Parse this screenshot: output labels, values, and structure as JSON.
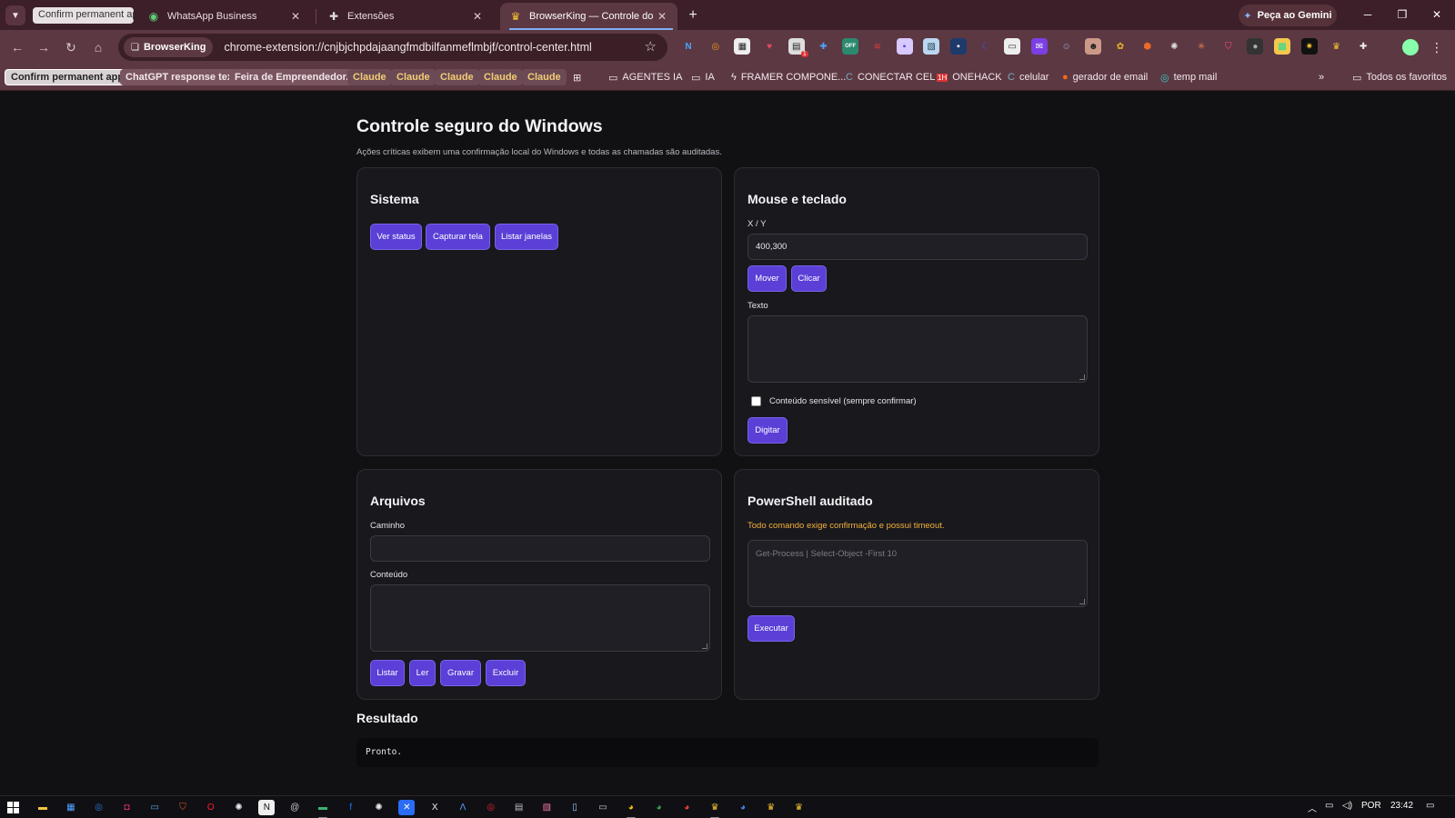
{
  "browser": {
    "tab_group_chip": "Confirm permanent ap",
    "tabs": [
      {
        "title": "WhatsApp Business",
        "icon": "whatsapp-icon"
      },
      {
        "title": "Extensões",
        "icon": "puzzle-icon"
      },
      {
        "title": "BrowserKing — Controle do W",
        "icon": "crown-icon"
      }
    ],
    "gemini_label": "Peça ao Gemini",
    "omnibox_chip": "BrowserKing",
    "url": "chrome-extension://cnjbjchpdajaangfmdbilfanmeflmbjf/control-center.html",
    "badge_count": "1",
    "badge_off": "OFF",
    "bookmarks": [
      {
        "label": "Confirm permanent app"
      },
      {
        "label": "ChatGPT response text"
      },
      {
        "label": "Feira de Empreendedor..."
      },
      {
        "label": "Claude"
      },
      {
        "label": "Claude"
      },
      {
        "label": "Claude"
      },
      {
        "label": "Claude"
      },
      {
        "label": "Claude"
      },
      {
        "label": "AGENTES IA"
      },
      {
        "label": "IA"
      },
      {
        "label": "FRAMER COMPONE..."
      },
      {
        "label": "CONECTAR CEL"
      },
      {
        "label": "ONEHACK"
      },
      {
        "label": "celular"
      },
      {
        "label": "gerador de email"
      },
      {
        "label": "temp mail"
      }
    ],
    "all_bookmarks": "Todos os favoritos"
  },
  "page": {
    "title": "Controle seguro do Windows",
    "subtitle": "Ações críticas exibem uma confirmação local do Windows e todas as chamadas são auditadas.",
    "sistema": {
      "title": "Sistema",
      "buttons": [
        "Ver status",
        "Capturar tela",
        "Listar janelas"
      ]
    },
    "mouse": {
      "title": "Mouse e teclado",
      "xy_label": "X / Y",
      "xy_value": "400,300",
      "move": "Mover",
      "click": "Clicar",
      "text_label": "Texto",
      "text_value": "",
      "sensitive_label": "Conteúdo sensível (sempre confirmar)",
      "type": "Digitar"
    },
    "arquivos": {
      "title": "Arquivos",
      "path_label": "Caminho",
      "path_value": "",
      "content_label": "Conteúdo",
      "content_value": "",
      "buttons": [
        "Listar",
        "Ler",
        "Gravar",
        "Excluir"
      ]
    },
    "powershell": {
      "title": "PowerShell auditado",
      "warning": "Todo comando exige confirmação e possui timeout.",
      "placeholder": "Get-Process | Select-Object -First 10",
      "run": "Executar"
    },
    "result": {
      "title": "Resultado",
      "output": "Pronto."
    }
  },
  "taskbar": {
    "language": "POR",
    "time": "23:42"
  },
  "colors": {
    "accent": "#5b3fd6",
    "warning": "#f5b13c",
    "chrome_frame": "#3c1f28",
    "chrome_toolbar": "#5c3843"
  }
}
